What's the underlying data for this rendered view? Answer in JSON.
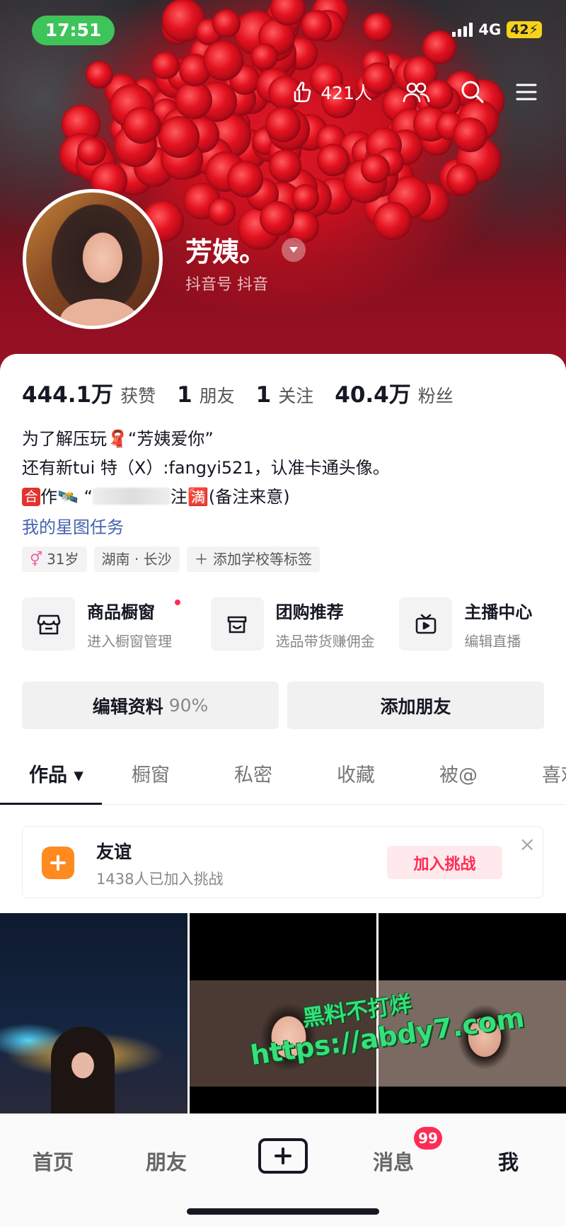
{
  "status_bar": {
    "time": "17:51",
    "network": "4G",
    "battery": "42"
  },
  "header": {
    "visitor_count": "421人",
    "nickname": "芳姨。",
    "douyin_id": "抖音号 抖音"
  },
  "stats": [
    {
      "num": "444.1万",
      "label": "获赞"
    },
    {
      "num": "1",
      "label": "朋友"
    },
    {
      "num": "1",
      "label": "关注"
    },
    {
      "num": "40.4万",
      "label": "粉丝"
    }
  ],
  "bio": {
    "line1": "为了解压玩🧣“芳姨爱你”",
    "line2": "还有新tui 特（X）:fangyi521，认准卡通头像。",
    "line3_badge": "合",
    "line3_a": "作🛰️ “",
    "line3_b": "注🈵(备注来意)",
    "xingtu": "我的星图任务"
  },
  "tags": {
    "age_icon": "⚥",
    "age": "31岁",
    "location": "湖南 · 长沙",
    "add_school": "＋ 添加学校等标签"
  },
  "tools": [
    {
      "icon": "storefront-icon",
      "title": "商品橱窗",
      "sub": "进入橱窗管理"
    },
    {
      "icon": "group-buy-icon",
      "title": "团购推荐",
      "sub": "选品带货赚佣金"
    },
    {
      "icon": "tv-icon",
      "title": "主播中心",
      "sub": "编辑直播"
    }
  ],
  "buttons": {
    "edit_profile": "编辑资料",
    "edit_pct": "90%",
    "add_friend": "添加朋友"
  },
  "tabs": [
    "作品 ▾",
    "橱窗",
    "私密",
    "收藏",
    "被@",
    "喜欢"
  ],
  "challenge": {
    "title": "友谊",
    "sub": "1438人已加入挑战",
    "button": "加入挑战",
    "close": "×"
  },
  "watermark": {
    "line1": "黑料不打烊",
    "line2": "https://abdy7.com"
  },
  "bottom_nav": {
    "home": "首页",
    "friends": "朋友",
    "messages": "消息",
    "messages_badge": "99",
    "me": "我"
  },
  "colors": {
    "accent": "#fe2c55",
    "link": "#4463ae",
    "status_green": "#3ec45a"
  }
}
